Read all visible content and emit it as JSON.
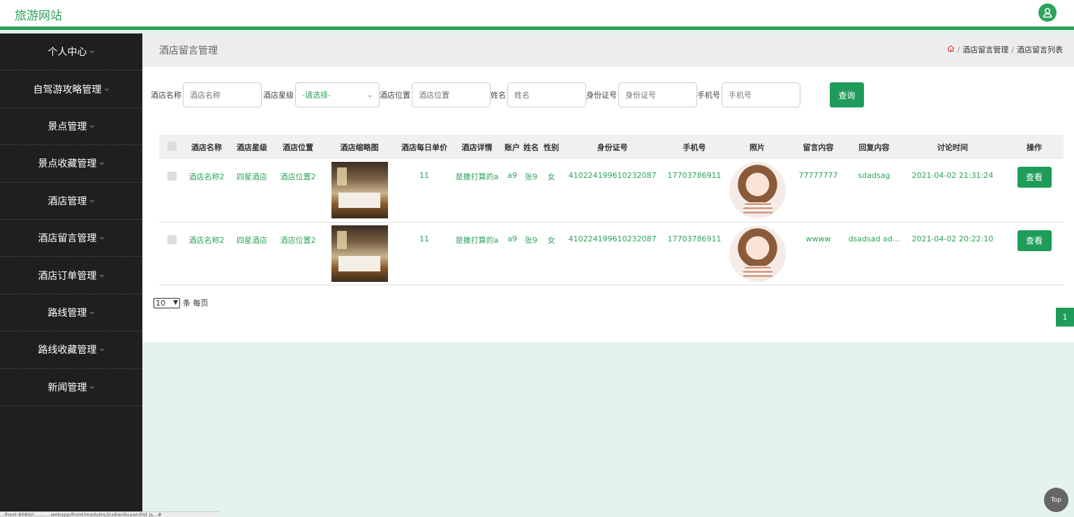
{
  "app": {
    "title": "旅游网站"
  },
  "sidebar": {
    "items": [
      {
        "label": "个人中心"
      },
      {
        "label": "自驾游攻略管理"
      },
      {
        "label": "景点管理"
      },
      {
        "label": "景点收藏管理"
      },
      {
        "label": "酒店管理"
      },
      {
        "label": "酒店留言管理"
      },
      {
        "label": "酒店订单管理"
      },
      {
        "label": "路线管理"
      },
      {
        "label": "路线收藏管理"
      },
      {
        "label": "新闻管理"
      }
    ]
  },
  "breadcrumb": {
    "page_title": "酒店留言管理",
    "path_1": "酒店留言管理",
    "path_2": "酒店留言列表",
    "separator": "/"
  },
  "search": {
    "hotel_name_label": "酒店名称",
    "hotel_name_placeholder": "酒店名称",
    "star_label": "酒店星级",
    "star_selected": "-请选择-",
    "location_label": "酒店位置",
    "location_placeholder": "酒店位置",
    "name_label": "姓名",
    "name_placeholder": "姓名",
    "idcard_label": "身份证号",
    "idcard_placeholder": "身份证号",
    "phone_label": "手机号",
    "phone_placeholder": "手机号",
    "query_button": "查询"
  },
  "table": {
    "headers": [
      "酒店名称",
      "酒店星级",
      "酒店位置",
      "酒店缩略图",
      "酒店每日单价",
      "酒店详情",
      "账户",
      "姓名",
      "性别",
      "身份证号",
      "手机号",
      "照片",
      "留言内容",
      "回复内容",
      "讨论时间",
      "操作"
    ],
    "rows": [
      {
        "hotel_name": "酒店名称2",
        "star": "四星酒店",
        "location": "酒店位置2",
        "price": "11",
        "detail": "是撒打算的a",
        "account": "a9",
        "name": "张9",
        "gender": "女",
        "idcard": "410224199610232087",
        "phone": "17703786911",
        "message": "77777777",
        "reply": "sdadsag",
        "time": "2021-04-02 21:31:24",
        "action": "查看"
      },
      {
        "hotel_name": "酒店名称2",
        "star": "四星酒店",
        "location": "酒店位置2",
        "price": "11",
        "detail": "是撒打算的a",
        "account": "a9",
        "name": "张9",
        "gender": "女",
        "idcard": "410224199610232087",
        "phone": "17703786911",
        "message": "wwww",
        "reply": "dsadsad ad...",
        "time": "2021-04-02 20:22:10",
        "action": "查看"
      }
    ]
  },
  "pagination": {
    "page_size": "10",
    "page_size_suffix": "条 每页",
    "current_page": "1"
  },
  "top_button": "Top",
  "status_bar": "...lhost:8080/l...........webapp/front/modules/jiudianliuyan/list.js...#"
}
